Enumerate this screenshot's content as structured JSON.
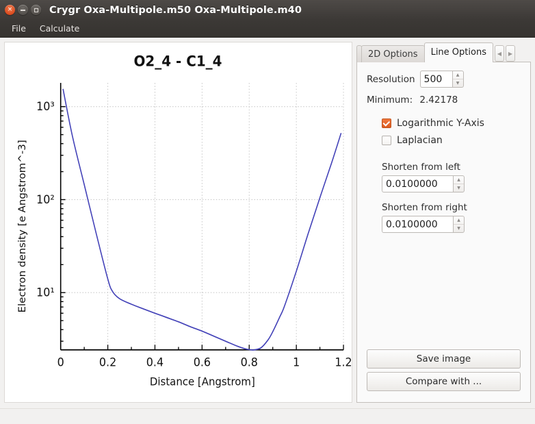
{
  "window": {
    "title": "Crygr Oxa-Multipole.m50 Oxa-Multipole.m40",
    "close_glyph": "×",
    "buttons": {
      "close": "close-button",
      "minimize": "minimize-button",
      "maximize": "maximize-button"
    }
  },
  "menubar": {
    "items": [
      {
        "label": "File"
      },
      {
        "label": "Calculate"
      }
    ]
  },
  "tabs": {
    "partial_label": "",
    "items": [
      {
        "label": "2D Options",
        "active": false
      },
      {
        "label": "Line Options",
        "active": true
      }
    ],
    "scroll_left": "◀",
    "scroll_right": "▶"
  },
  "panel": {
    "resolution_label": "Resolution",
    "resolution_value": "500",
    "minimum_label": "Minimum:",
    "minimum_value": "2.42178",
    "log_y_label": "Logarithmic Y-Axis",
    "log_y_checked": true,
    "laplacian_label": "Laplacian",
    "laplacian_checked": false,
    "shorten_left_label": "Shorten from left",
    "shorten_left_value": "0.0100000",
    "shorten_right_label": "Shorten from right",
    "shorten_right_value": "0.0100000",
    "save_image_label": "Save image",
    "compare_with_label": "Compare with ...",
    "spin_up": "▲",
    "spin_down": "▼"
  },
  "chart_data": {
    "type": "line",
    "title": "O2_4 - C1_4",
    "xlabel": "Distance [Angstrom]",
    "ylabel": "Electron density [e Angstrom^-3]",
    "xlim": [
      0,
      1.2
    ],
    "ylim": [
      2.42178,
      1800
    ],
    "yscale": "log",
    "grid": true,
    "legend": null,
    "line_color": "#4342b8",
    "xticks": [
      "0",
      "0.2",
      "0.4",
      "0.6",
      "0.8",
      "1",
      "1.2"
    ],
    "xtick_values": [
      0,
      0.2,
      0.4,
      0.6,
      0.8,
      1.0,
      1.2
    ],
    "yticks": [
      "10³",
      "10²",
      "10¹"
    ],
    "ytick_values": [
      1000,
      100,
      10
    ],
    "series": [
      {
        "name": "electron density",
        "x": [
          0.01,
          0.05,
          0.1,
          0.15,
          0.2,
          0.22,
          0.25,
          0.3,
          0.35,
          0.4,
          0.45,
          0.5,
          0.55,
          0.6,
          0.65,
          0.7,
          0.75,
          0.78,
          0.8,
          0.82,
          0.85,
          0.88,
          0.9,
          0.93,
          0.95,
          1.0,
          1.05,
          1.1,
          1.15,
          1.19
        ],
        "y": [
          1550,
          480,
          145,
          44.0,
          14.0,
          10.3,
          8.6,
          7.5,
          6.7,
          6.0,
          5.4,
          4.85,
          4.3,
          3.85,
          3.4,
          3.0,
          2.65,
          2.5,
          2.44,
          2.42178,
          2.55,
          3.1,
          3.8,
          5.5,
          7.2,
          17.0,
          43.0,
          105,
          250,
          520
        ]
      }
    ]
  }
}
